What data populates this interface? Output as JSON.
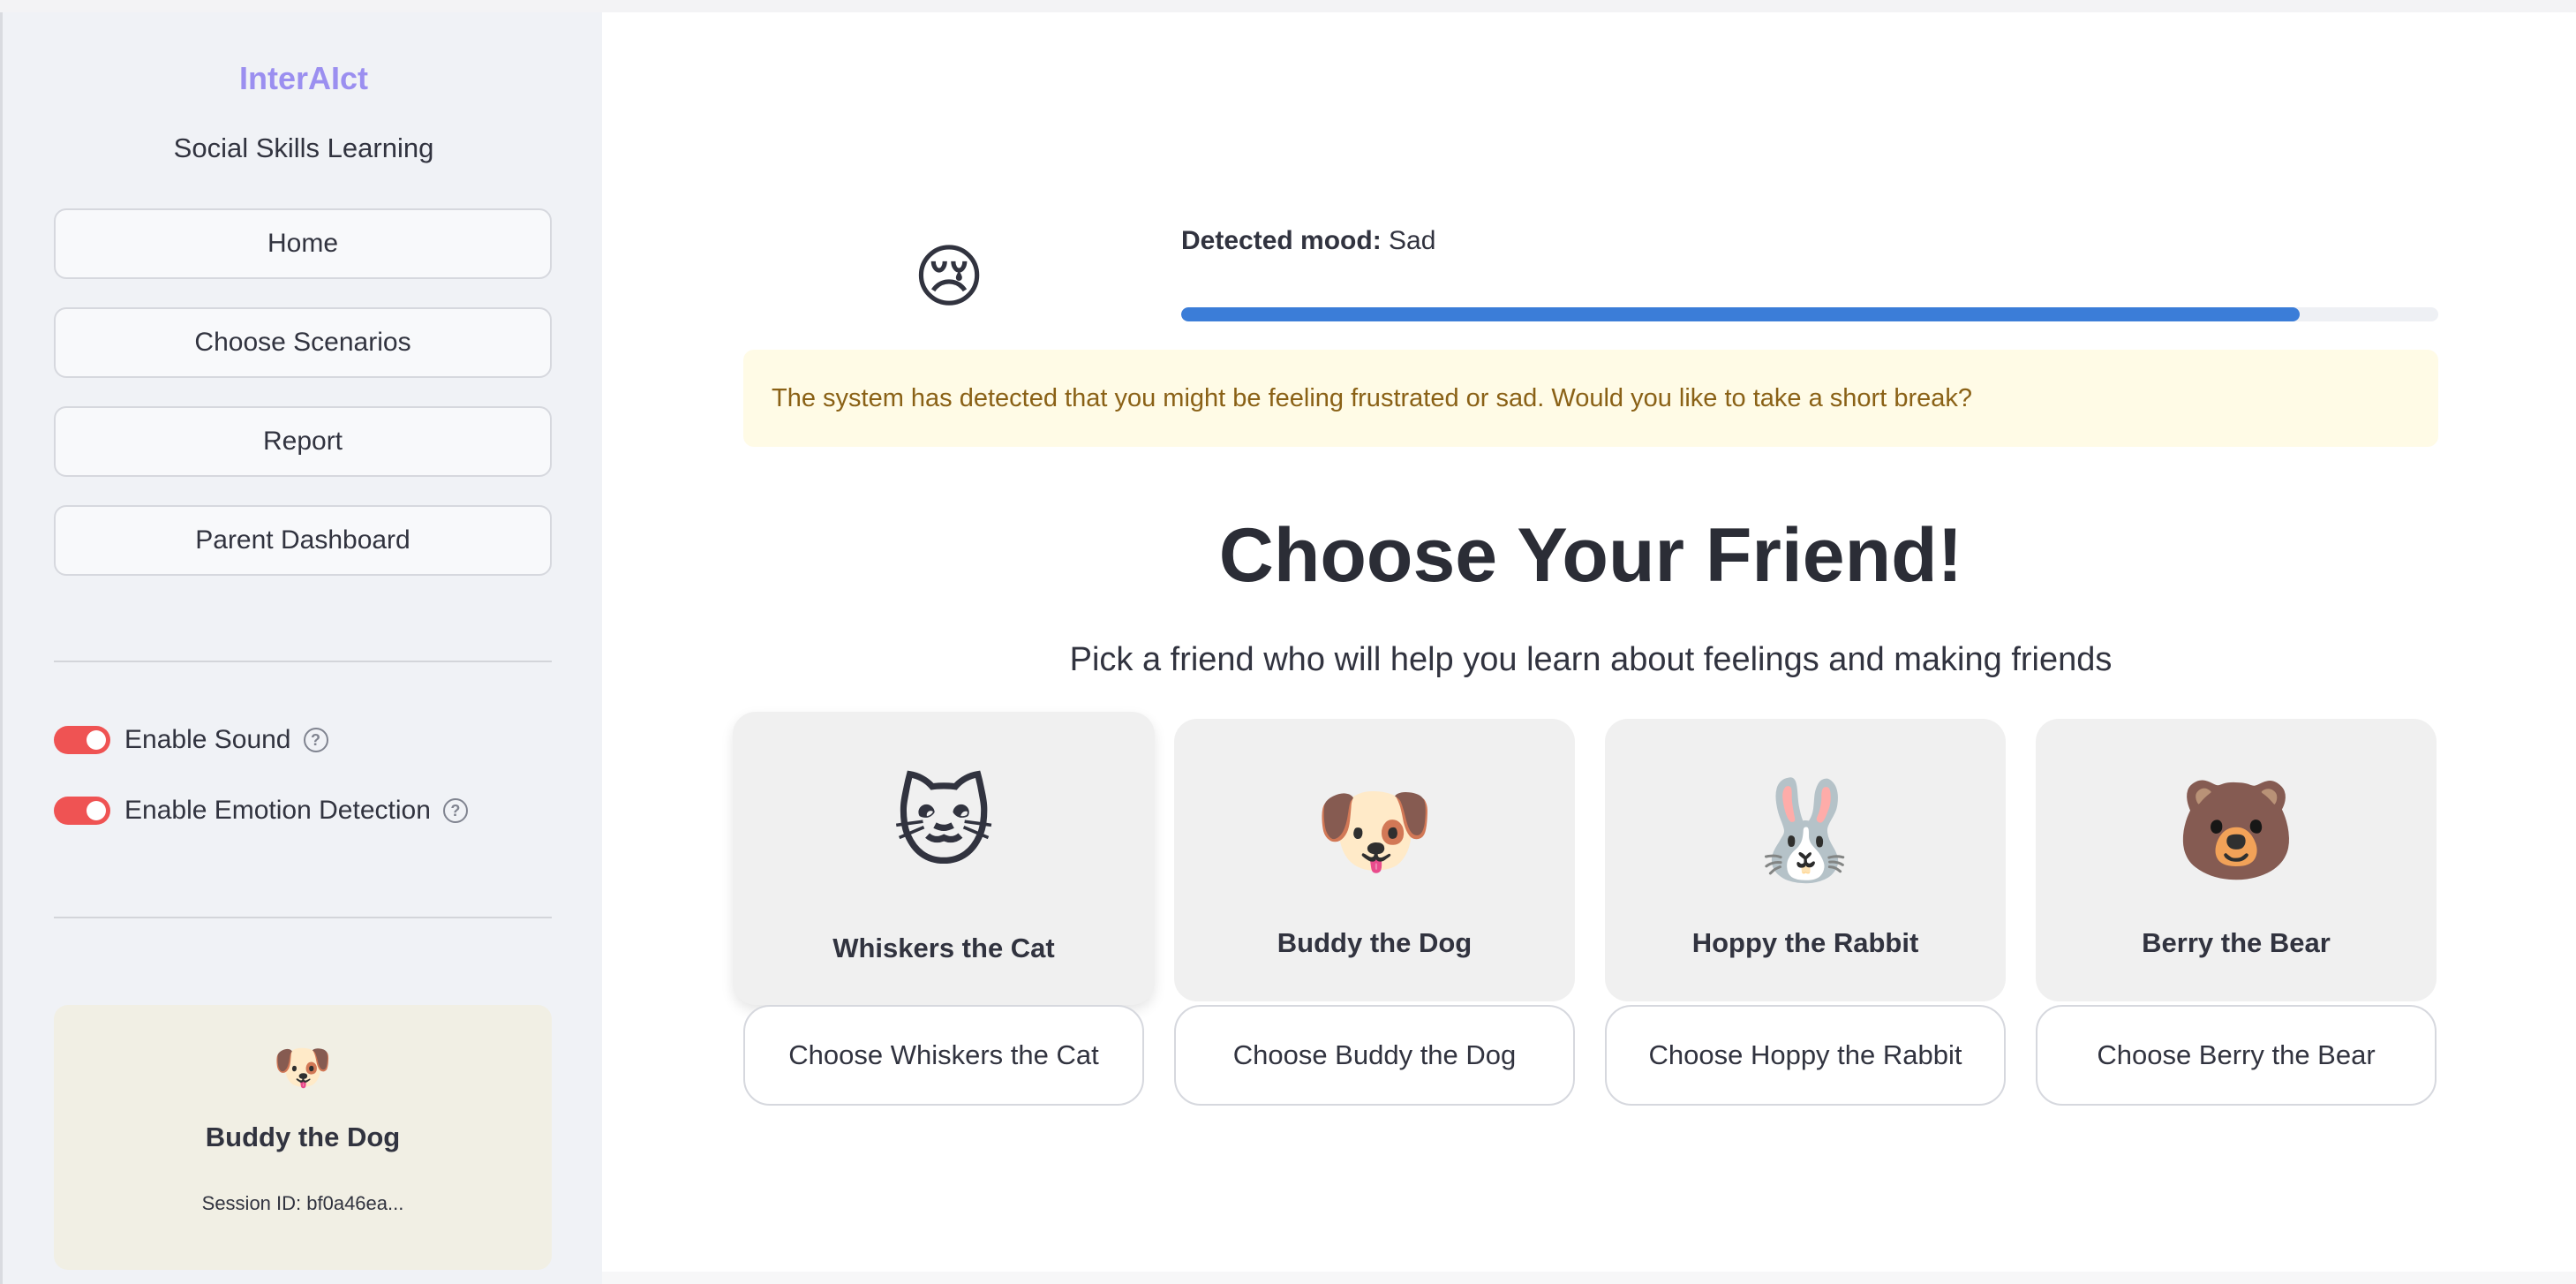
{
  "sidebar": {
    "brand": "InterAIct",
    "subtitle": "Social Skills Learning",
    "nav": [
      "Home",
      "Choose Scenarios",
      "Report",
      "Parent Dashboard"
    ],
    "toggles": [
      {
        "label": "Enable Sound",
        "on": true
      },
      {
        "label": "Enable Emotion Detection",
        "on": true
      }
    ],
    "help_glyph": "?",
    "current_friend": {
      "emoji": "🐶",
      "name": "Buddy the Dog",
      "session": "Session ID: bf0a46ea..."
    }
  },
  "mood": {
    "emoji": "😢",
    "label": "Detected mood:",
    "value": "Sad",
    "confidence_fraction": 0.89,
    "bar_color": "#3b7dd8"
  },
  "alert": {
    "text": "The system has detected that you might be feeling frustrated or sad. Would you like to take a short break?"
  },
  "main": {
    "title": "Choose Your Friend!",
    "subtitle": "Pick a friend who will help you learn about feelings and making friends"
  },
  "friends": [
    {
      "emoji": "🐱",
      "name": "Whiskers the Cat",
      "button": "Choose Whiskers the Cat"
    },
    {
      "emoji": "🐶",
      "name": "Buddy the Dog",
      "button": "Choose Buddy the Dog"
    },
    {
      "emoji": "🐰",
      "name": "Hoppy the Rabbit",
      "button": "Choose Hoppy the Rabbit"
    },
    {
      "emoji": "🐻",
      "name": "Berry the Bear",
      "button": "Choose Berry the Bear"
    }
  ],
  "colors": {
    "brand": "#9b8ff0",
    "toggle_on": "#ef5353",
    "alert_bg": "#fffbe6",
    "alert_text": "#8a6116"
  }
}
